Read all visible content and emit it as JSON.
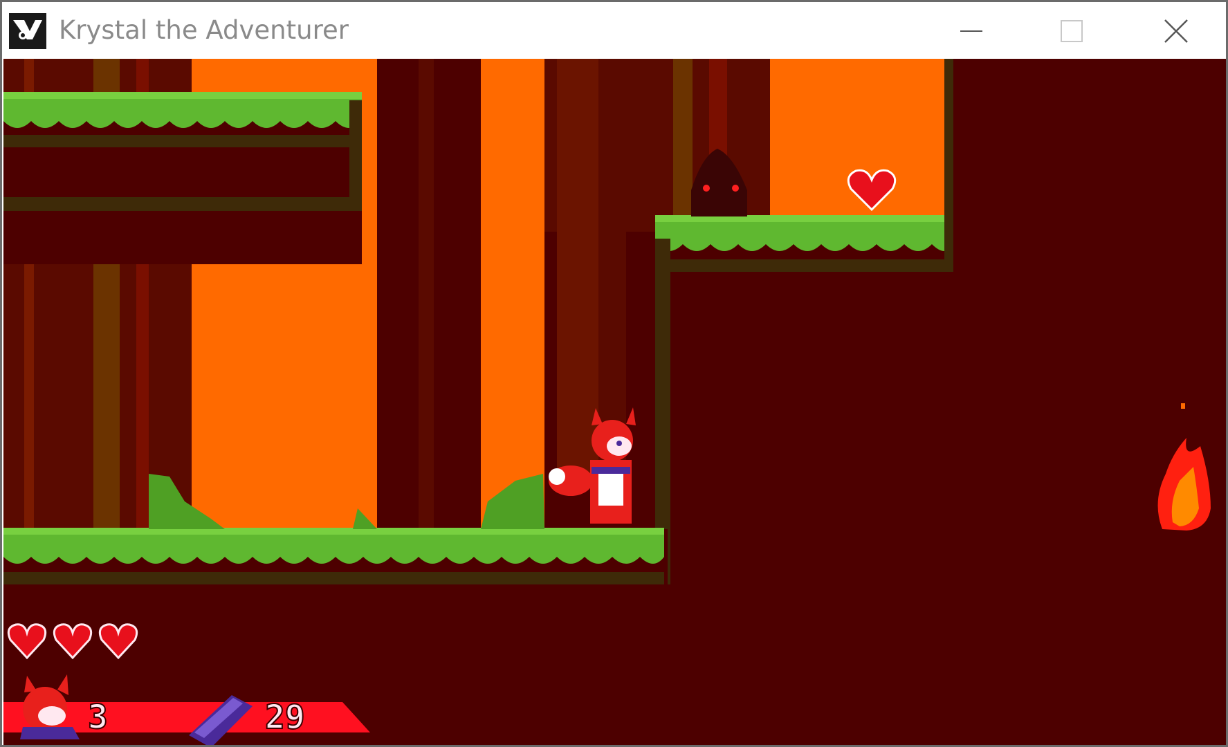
{
  "window": {
    "title": "Krystal the Adventurer",
    "controls": {
      "minimize": "minimize",
      "maximize": "maximize",
      "close": "close"
    }
  },
  "game": {
    "colors": {
      "sky": "#ff6a00",
      "bark": "#4d0000",
      "dark_trunk": "#5a0a00",
      "olive_trunk": "#6b3300",
      "grass": "#5fb830",
      "grass_light": "#78d040",
      "dirt": "#3e2a08",
      "heart": "#e8101c",
      "hud_bar": "#ff1020",
      "crystal": "#4a2a9a"
    },
    "hud": {
      "health": 3,
      "health_max": 3,
      "lives": "3",
      "crystals": "29"
    },
    "icons": {
      "life": "fox-face-icon",
      "crystal": "purple-crystal-icon",
      "heart": "heart-icon"
    }
  }
}
